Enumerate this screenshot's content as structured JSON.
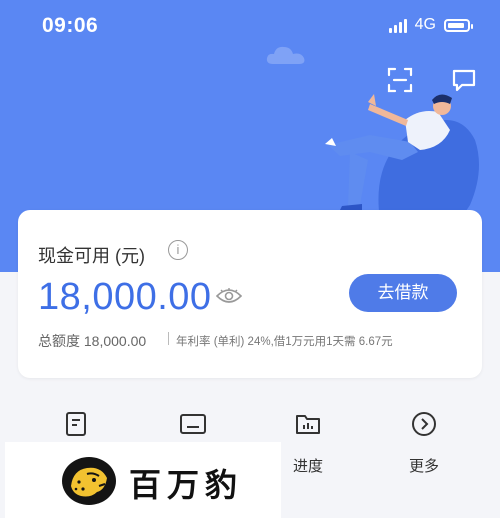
{
  "status_bar": {
    "time": "09:06",
    "network": "4G"
  },
  "top_bar": {
    "icons": [
      "scan-icon",
      "message-icon"
    ]
  },
  "card": {
    "cash_label": "现金可用 (元)",
    "amount": "18,000.00",
    "borrow_button": "去借款",
    "quota": "总额度 18,000.00",
    "rate_note": "年利率 (单利) 24%,借1万元用1天需 6.67元"
  },
  "nav": [
    {
      "label": "",
      "icon": "document-icon"
    },
    {
      "label": "",
      "icon": "card-icon"
    },
    {
      "label": "进度",
      "icon": "folder-chart-icon"
    },
    {
      "label": "更多",
      "icon": "chevron-circle-icon"
    }
  ],
  "banner": {
    "brand": "百万豹"
  },
  "colors": {
    "accent": "#5a87f3",
    "button": "#4f7be8",
    "amount": "#3e6fe6"
  }
}
